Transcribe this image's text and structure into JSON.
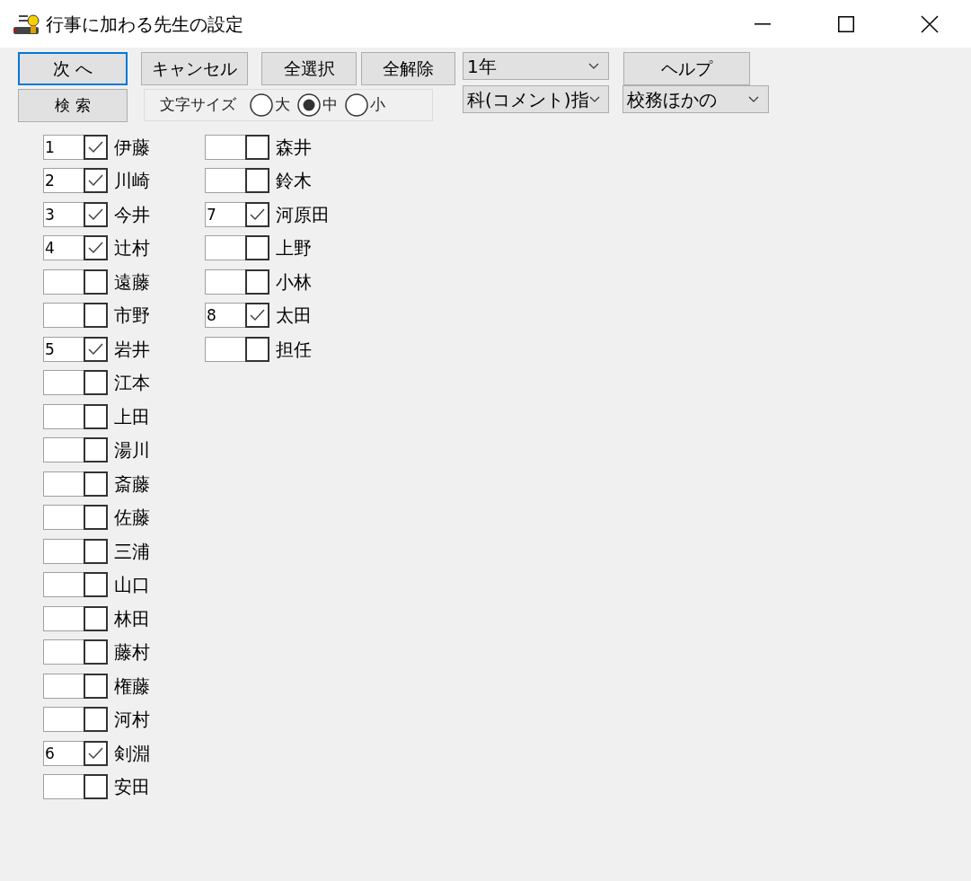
{
  "window": {
    "title": "行事に加わる先生の設定"
  },
  "toolbar": {
    "row_1": [
      {
        "kind": "button",
        "label": "次 へ",
        "focused": true
      },
      {
        "kind": "button",
        "label": "キャンセル",
        "focused": false
      },
      {
        "kind": "button",
        "label": "全選択",
        "focused": false
      },
      {
        "kind": "button",
        "label": "全解除",
        "focused": false
      },
      {
        "kind": "dropdown",
        "value": "1年"
      },
      {
        "kind": "button",
        "label": "ヘルプ",
        "focused": false
      }
    ],
    "row_2": [
      {
        "kind": "button",
        "label": "検 索",
        "focused": false
      },
      {
        "kind": "radio_group",
        "label": "文字サイズ",
        "options": [
          {
            "label": "大",
            "selected": false
          },
          {
            "label": "中",
            "selected": true
          },
          {
            "label": "小",
            "selected": false
          }
        ]
      },
      {
        "kind": "dropdown",
        "value": "科(コメント)指"
      },
      {
        "kind": "dropdown",
        "value": "校務ほかの"
      }
    ]
  },
  "teachers": {
    "column_1": [
      {
        "number": "1",
        "checked": true,
        "name": "伊藤"
      },
      {
        "number": "2",
        "checked": true,
        "name": "川崎"
      },
      {
        "number": "3",
        "checked": true,
        "name": "今井"
      },
      {
        "number": "4",
        "checked": true,
        "name": "辻村"
      },
      {
        "checked": false,
        "name": "遠藤"
      },
      {
        "checked": false,
        "name": "市野"
      },
      {
        "number": "5",
        "checked": true,
        "name": "岩井"
      },
      {
        "checked": false,
        "name": "江本"
      },
      {
        "checked": false,
        "name": "上田"
      },
      {
        "checked": false,
        "name": "湯川"
      },
      {
        "checked": false,
        "name": "斎藤"
      },
      {
        "checked": false,
        "name": "佐藤"
      },
      {
        "checked": false,
        "name": "三浦"
      },
      {
        "checked": false,
        "name": "山口"
      },
      {
        "checked": false,
        "name": "林田"
      },
      {
        "checked": false,
        "name": "藤村"
      },
      {
        "checked": false,
        "name": "権藤"
      },
      {
        "checked": false,
        "name": "河村"
      },
      {
        "number": "6",
        "checked": true,
        "name": "剣淵"
      },
      {
        "checked": false,
        "name": "安田"
      }
    ],
    "column_2": [
      {
        "checked": false,
        "name": "森井"
      },
      {
        "checked": false,
        "name": "鈴木"
      },
      {
        "number": "7",
        "checked": true,
        "name": "河原田"
      },
      {
        "checked": false,
        "name": "上野"
      },
      {
        "checked": false,
        "name": "小林"
      },
      {
        "number": "8",
        "checked": true,
        "name": "太田"
      },
      {
        "checked": false,
        "name": "担任"
      }
    ]
  }
}
